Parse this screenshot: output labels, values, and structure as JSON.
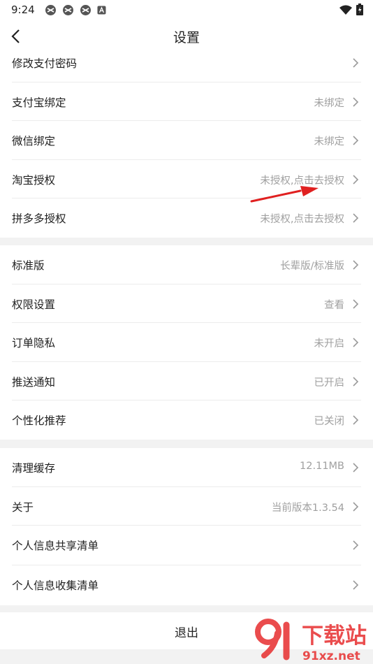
{
  "status": {
    "time": "9:24"
  },
  "header": {
    "title": "设置"
  },
  "group1": [
    {
      "label": "修改支付密码",
      "value": ""
    },
    {
      "label": "支付宝绑定",
      "value": "未绑定"
    },
    {
      "label": "微信绑定",
      "value": "未绑定"
    },
    {
      "label": "淘宝授权",
      "value": "未授权,点击去授权"
    },
    {
      "label": "拼多多授权",
      "value": "未授权,点击去授权"
    }
  ],
  "group2": [
    {
      "label": "标准版",
      "value": "长辈版/标准版"
    },
    {
      "label": "权限设置",
      "value": "查看"
    },
    {
      "label": "订单隐私",
      "value": "未开启"
    },
    {
      "label": "推送通知",
      "value": "已开启"
    },
    {
      "label": "个性化推荐",
      "value": "已关闭"
    }
  ],
  "group3": [
    {
      "label": "清理缓存",
      "value": "12.11MB"
    },
    {
      "label": "关于",
      "value": "当前版本1.3.54"
    },
    {
      "label": "个人信息共享清单",
      "value": ""
    },
    {
      "label": "个人信息收集清单",
      "value": ""
    }
  ],
  "logout": {
    "label": "退出"
  },
  "watermark": {
    "name": "下载站",
    "url": "91xz.net"
  },
  "colors": {
    "value_text": "#a0a0a0",
    "arrow": "#e02020",
    "watermark": "#e8393a"
  }
}
